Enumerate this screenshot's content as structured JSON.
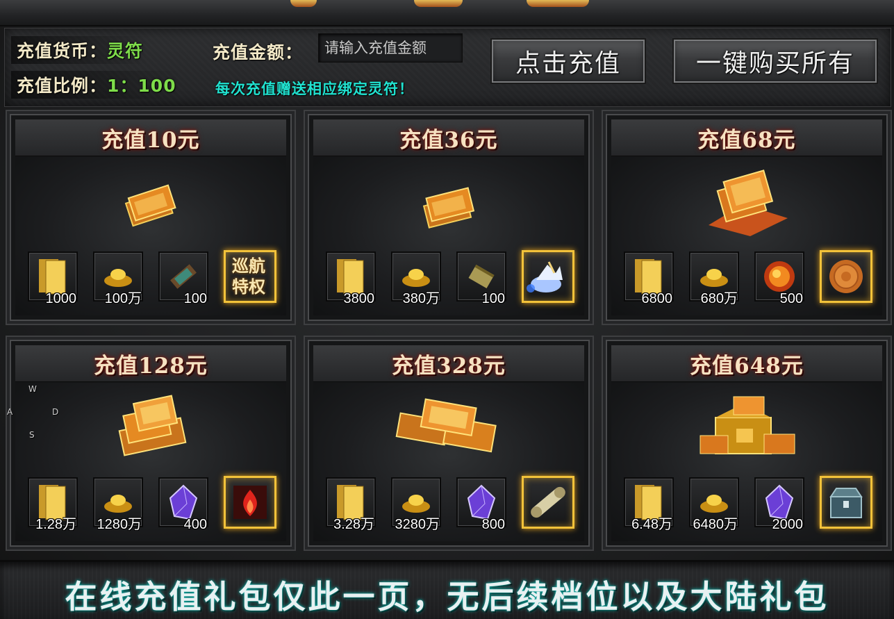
{
  "header": {
    "currency_label": "充值货币：",
    "currency_value": "灵符",
    "ratio_label": "充值比例：",
    "ratio_value": "1：100",
    "amount_label": "充值金额：",
    "amount_placeholder": "请输入充值金额",
    "bonus_note": "每次充值赠送相应绑定灵符！",
    "recharge_button": "点击充值",
    "buy_all_button": "一键购买所有"
  },
  "packs": [
    {
      "title": "充值10元",
      "items": [
        {
          "icon": "lingfu-ticket-icon",
          "qty": "1000"
        },
        {
          "icon": "gold-ingot-icon",
          "qty": "100万"
        },
        {
          "icon": "scroll-icon",
          "qty": "100"
        },
        {
          "icon": "cruise-privilege-icon",
          "text": "巡航特权",
          "featured": true
        }
      ]
    },
    {
      "title": "充值36元",
      "items": [
        {
          "icon": "lingfu-ticket-icon",
          "qty": "3800"
        },
        {
          "icon": "gold-ingot-icon",
          "qty": "380万"
        },
        {
          "icon": "old-scroll-icon",
          "qty": "100"
        },
        {
          "icon": "mount-icon",
          "featured": true
        }
      ]
    },
    {
      "title": "充值68元",
      "items": [
        {
          "icon": "lingfu-ticket-icon",
          "qty": "6800"
        },
        {
          "icon": "gold-ingot-icon",
          "qty": "680万"
        },
        {
          "icon": "fire-orb-icon",
          "qty": "500"
        },
        {
          "icon": "mooncake-icon",
          "featured": true
        }
      ]
    },
    {
      "title": "充值128元",
      "items": [
        {
          "icon": "lingfu-ticket-icon",
          "qty": "1.28万"
        },
        {
          "icon": "gold-ingot-icon",
          "qty": "1280万"
        },
        {
          "icon": "crystal-icon",
          "qty": "400"
        },
        {
          "icon": "flame-icon",
          "featured": true
        }
      ]
    },
    {
      "title": "充值328元",
      "items": [
        {
          "icon": "lingfu-ticket-icon",
          "qty": "3.28万"
        },
        {
          "icon": "gold-ingot-icon",
          "qty": "3280万"
        },
        {
          "icon": "crystal-icon",
          "qty": "800"
        },
        {
          "icon": "rolled-scroll-icon",
          "featured": true
        }
      ]
    },
    {
      "title": "充值648元",
      "items": [
        {
          "icon": "lingfu-ticket-icon",
          "qty": "6.48万"
        },
        {
          "icon": "gold-ingot-icon",
          "qty": "6480万"
        },
        {
          "icon": "crystal-icon",
          "qty": "2000"
        },
        {
          "icon": "treasure-chest-icon",
          "featured": true
        }
      ]
    }
  ],
  "wasd": {
    "w": "W",
    "a": "A",
    "s": "S",
    "d": "D"
  },
  "footer": {
    "text": "在线充值礼包仅此一页，无后续档位以及大陆礼包"
  },
  "colors": {
    "accent_gold": "#f2c23a",
    "title_text": "#f6e2c2",
    "note_cyan": "#21e2d0",
    "value_green": "#7edc4a"
  }
}
